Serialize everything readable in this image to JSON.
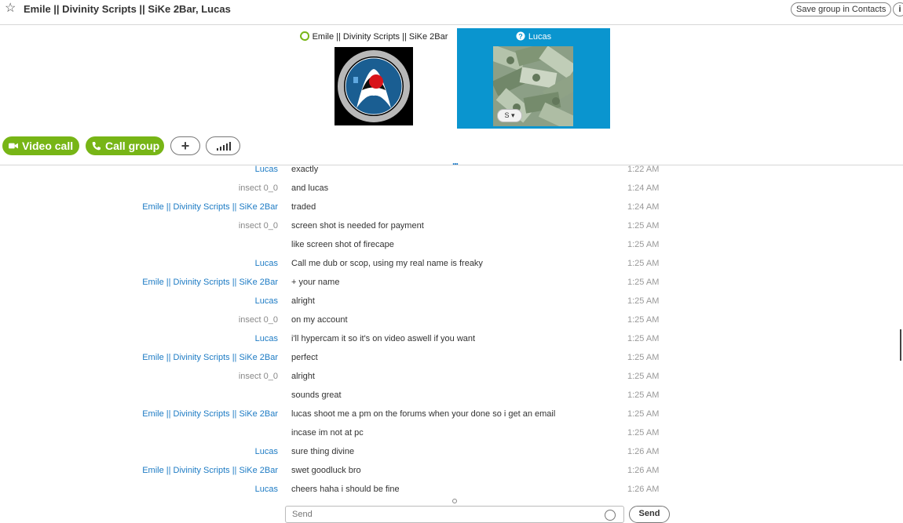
{
  "header": {
    "title": "Emile || Divinity Scripts || SiKe 2Bar, Lucas",
    "save_label": "Save group in Contacts",
    "info_label": "i"
  },
  "participants": [
    {
      "name": "Emile || Divinity Scripts || SiKe 2Bar",
      "status": "online",
      "status_color": "#77b516"
    },
    {
      "name": "Lucas",
      "status": "unknown",
      "highlight_color": "#0a95cf"
    }
  ],
  "actions": {
    "video_call": "Video call",
    "call_group": "Call group",
    "add": "+",
    "accent_color": "#77b516"
  },
  "more_indicator": "...",
  "messages": [
    {
      "sender": "Lucas",
      "sender_style": "blue",
      "text": "exactly",
      "time": "1:22 AM"
    },
    {
      "sender": "insect 0_0",
      "sender_style": "gray",
      "text": "and lucas",
      "time": "1:24 AM"
    },
    {
      "sender": "Emile || Divinity Scripts || SiKe 2Bar",
      "sender_style": "blue",
      "text": "traded",
      "time": "1:24 AM"
    },
    {
      "sender": "insect 0_0",
      "sender_style": "gray",
      "text": "screen shot is needed for payment",
      "time": "1:25 AM"
    },
    {
      "sender": "",
      "sender_style": "gray",
      "text": "like screen shot of firecape",
      "time": "1:25 AM"
    },
    {
      "sender": "Lucas",
      "sender_style": "blue",
      "text": "Call me dub or scop, using my real name is freaky",
      "time": "1:25 AM"
    },
    {
      "sender": "Emile || Divinity Scripts || SiKe 2Bar",
      "sender_style": "blue",
      "text": "+ your name",
      "time": "1:25 AM"
    },
    {
      "sender": "Lucas",
      "sender_style": "blue",
      "text": "alright",
      "time": "1:25 AM"
    },
    {
      "sender": "insect 0_0",
      "sender_style": "gray",
      "text": "on my account",
      "time": "1:25 AM"
    },
    {
      "sender": "Lucas",
      "sender_style": "blue",
      "text": "i'll hypercam it so it's on video aswell if you want",
      "time": "1:25 AM"
    },
    {
      "sender": "Emile || Divinity Scripts || SiKe 2Bar",
      "sender_style": "blue",
      "text": "perfect",
      "time": "1:25 AM"
    },
    {
      "sender": "insect 0_0",
      "sender_style": "gray",
      "text": "alright",
      "time": "1:25 AM"
    },
    {
      "sender": "",
      "sender_style": "gray",
      "text": "sounds great",
      "time": "1:25 AM"
    },
    {
      "sender": "Emile || Divinity Scripts || SiKe 2Bar",
      "sender_style": "blue",
      "text": "lucas shoot me a pm on the forums when your done so i get an email",
      "time": "1:25 AM"
    },
    {
      "sender": "",
      "sender_style": "gray",
      "text": "incase im not at pc",
      "time": "1:25 AM"
    },
    {
      "sender": "Lucas",
      "sender_style": "blue",
      "text": "sure thing divine",
      "time": "1:26 AM"
    },
    {
      "sender": "Emile || Divinity Scripts || SiKe 2Bar",
      "sender_style": "blue",
      "text": "swet goodluck bro",
      "time": "1:26 AM"
    },
    {
      "sender": "Lucas",
      "sender_style": "blue",
      "text": "cheers haha i should be fine",
      "time": "1:26 AM"
    }
  ],
  "compose": {
    "placeholder": "Send",
    "send_label": "Send"
  }
}
